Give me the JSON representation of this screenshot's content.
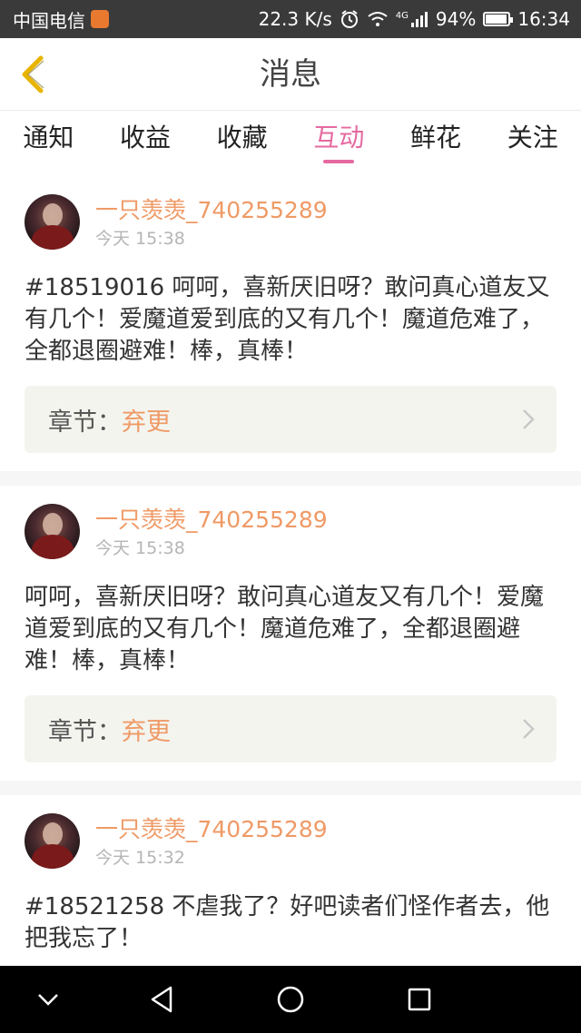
{
  "status_bar": {
    "carrier": "中国电信",
    "speed": "22.3 K/s",
    "signal_label": "4G",
    "battery": "94%",
    "battery_level": 0.94,
    "time": "16:34"
  },
  "header": {
    "title": "消息"
  },
  "tabs": [
    {
      "label": "通知",
      "active": false
    },
    {
      "label": "收益",
      "active": false
    },
    {
      "label": "收藏",
      "active": false
    },
    {
      "label": "互动",
      "active": true
    },
    {
      "label": "鲜花",
      "active": false
    },
    {
      "label": "关注",
      "active": false
    }
  ],
  "messages": [
    {
      "username": "一只羡羡_740255289",
      "time": "今天 15:38",
      "content": "#18519016 呵呵，喜新厌旧呀？敢问真心道友又有几个！爱魔道爱到底的又有几个！魔道危难了，全都退圈避难！棒，真棒！",
      "chapter_label": "章节：",
      "chapter_name": "弃更"
    },
    {
      "username": "一只羡羡_740255289",
      "time": "今天 15:38",
      "content": "呵呵，喜新厌旧呀？敢问真心道友又有几个！爱魔道爱到底的又有几个！魔道危难了，全都退圈避难！棒，真棒！",
      "chapter_label": "章节：",
      "chapter_name": "弃更"
    },
    {
      "username": "一只羡羡_740255289",
      "time": "今天 15:32",
      "content": "#18521258 不虐我了？好吧读者们怪作者去，他把我忘了！"
    }
  ],
  "colors": {
    "accent": "#e56aa0",
    "username": "#ef9a66",
    "status_bar": "#3a3a3a",
    "nav_bar": "#000000"
  }
}
